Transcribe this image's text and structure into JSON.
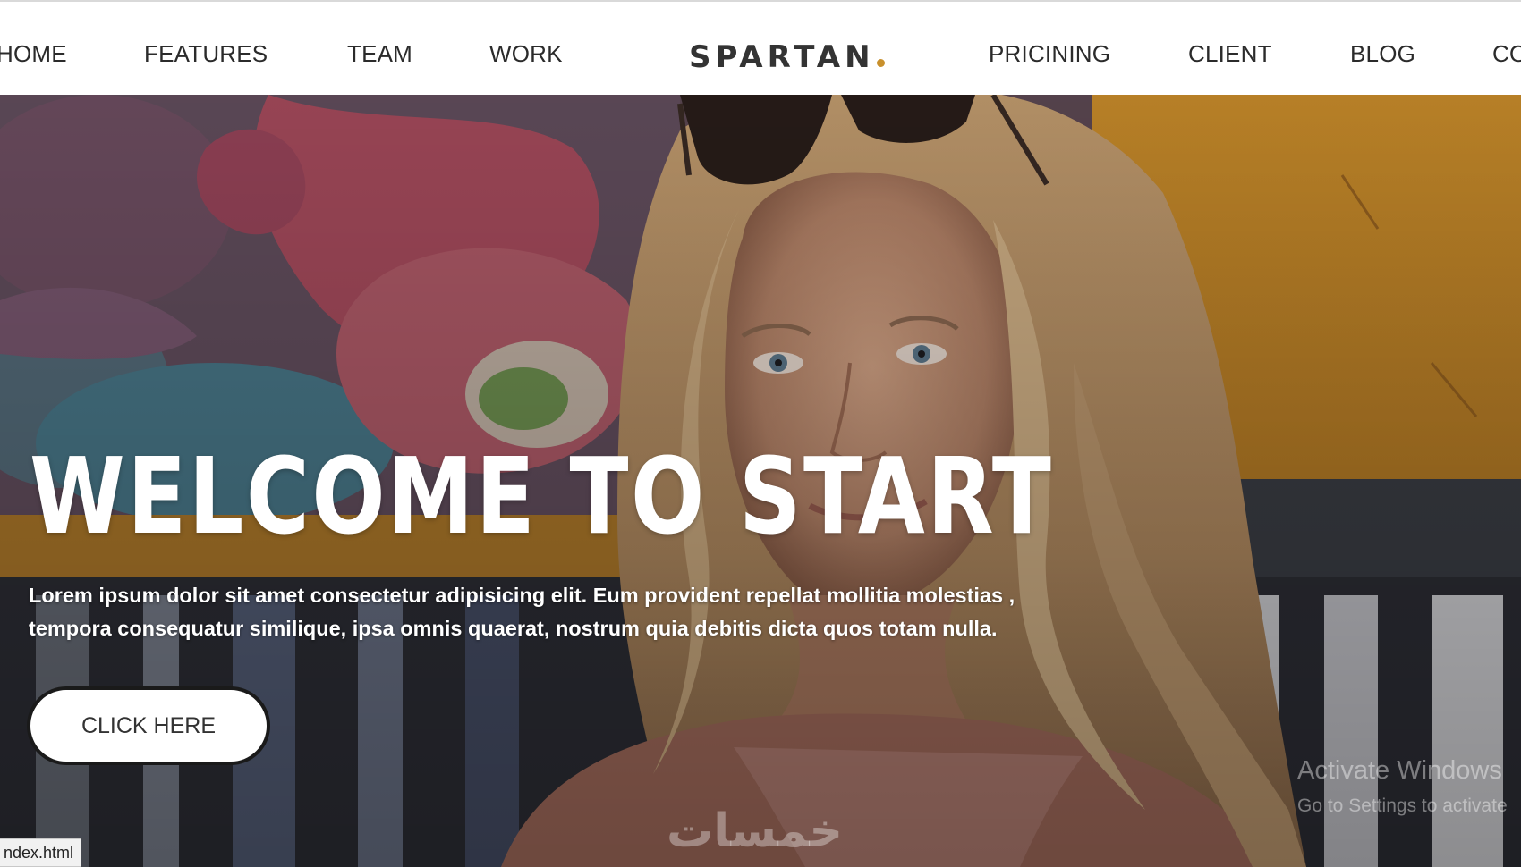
{
  "nav": {
    "left_items": [
      "HOME",
      "FEATURES",
      "TEAM",
      "WORK"
    ],
    "brand": "SPARTAN",
    "brand_dot_color": "#c8902d",
    "right_items": [
      "PRICINING",
      "CLIENT",
      "BLOG",
      "CO"
    ]
  },
  "hero": {
    "title": "WELCOME TO START",
    "text": "Lorem ipsum dolor sit amet consectetur adipisicing elit. Eum provident repellat mollitia molestias , tempora consequatur similique, ipsa omnis quaerat, nostrum quia debitis dicta quos totam nulla.",
    "button_label": "CLICK HERE"
  },
  "overlay": {
    "watermark_line1": "Activate Windows",
    "watermark_line2": "Go to Settings to activate",
    "arabic_logo": "خمسات"
  },
  "status_bar": {
    "url": "ndex.html"
  },
  "colors": {
    "accent": "#c8902d",
    "nav_text": "#2b2b2b",
    "hero_text": "#ffffff"
  }
}
